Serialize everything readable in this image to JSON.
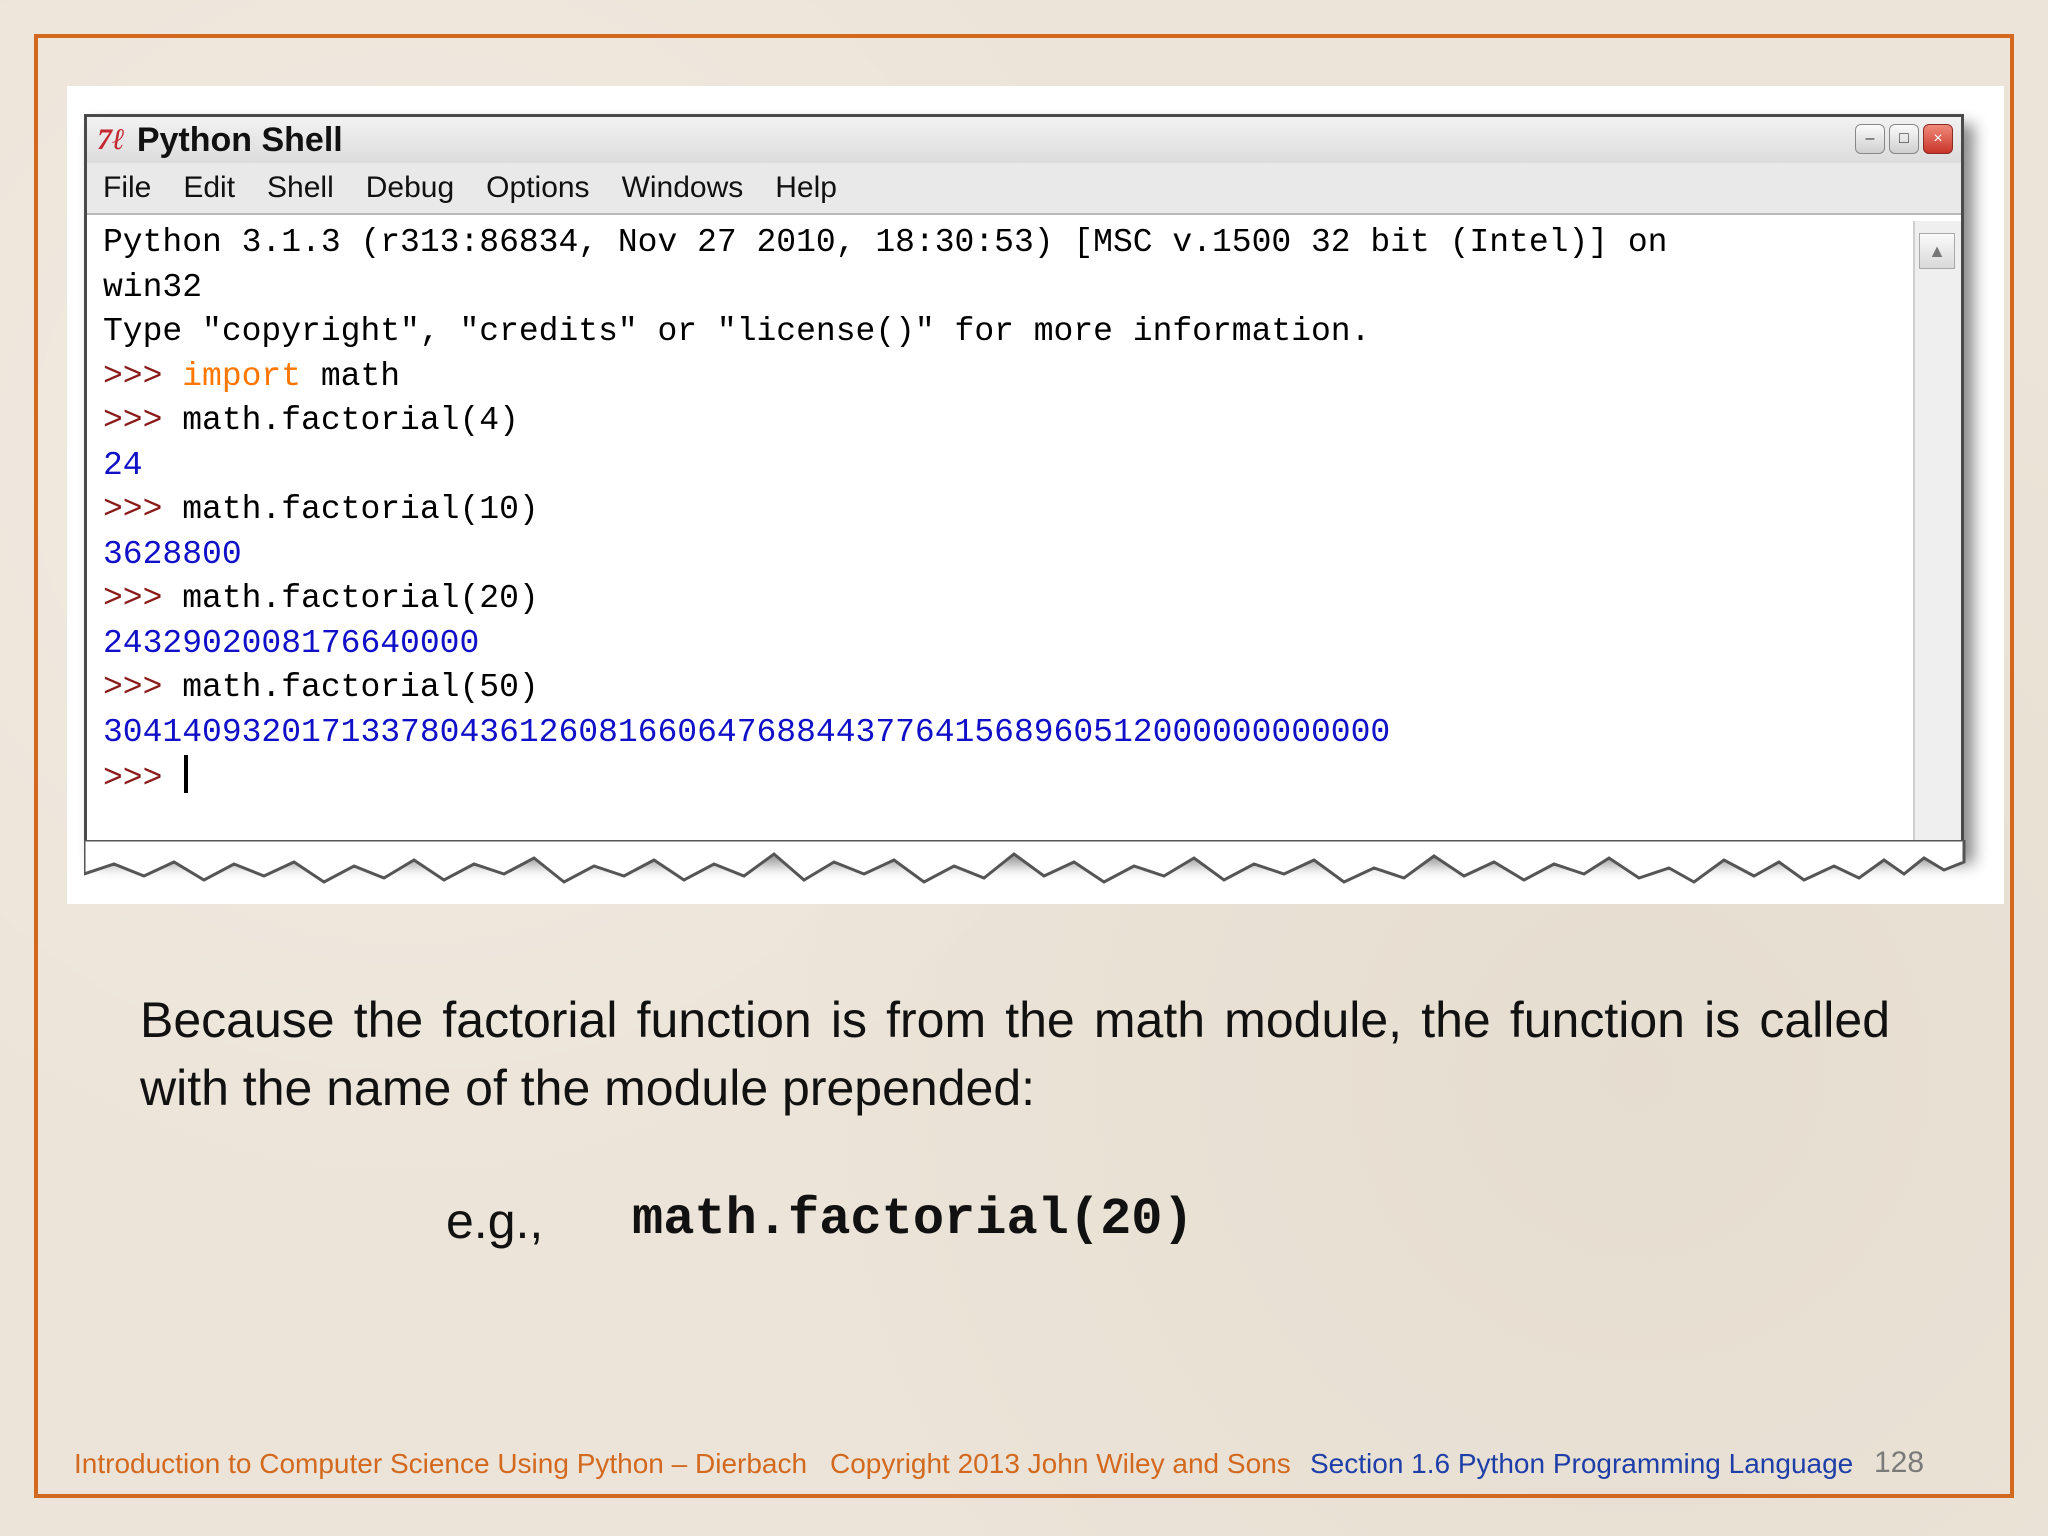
{
  "window": {
    "icon": "tk-icon",
    "icon_text": "7ℓ",
    "title": "Python Shell",
    "buttons": {
      "minimize": "–",
      "maximize": "□",
      "close": "×"
    }
  },
  "menu": [
    "File",
    "Edit",
    "Shell",
    "Debug",
    "Options",
    "Windows",
    "Help"
  ],
  "shell": {
    "lines": [
      {
        "parts": [
          {
            "text": "Python 3.1.3 (r313:86834, Nov 27 2010, 18:30:53) [MSC v.1500 32 bit (Intel)] on",
            "style": "plain"
          }
        ]
      },
      {
        "parts": [
          {
            "text": "win32",
            "style": "plain"
          }
        ]
      },
      {
        "parts": [
          {
            "text": "Type \"copyright\", \"credits\" or \"license()\" for more information.",
            "style": "plain"
          }
        ]
      },
      {
        "parts": [
          {
            "text": ">>> ",
            "style": "prompt"
          },
          {
            "text": "import",
            "style": "kw"
          },
          {
            "text": " math",
            "style": "plain"
          }
        ]
      },
      {
        "parts": [
          {
            "text": ">>> ",
            "style": "prompt"
          },
          {
            "text": "math.factorial(4)",
            "style": "plain"
          }
        ]
      },
      {
        "parts": [
          {
            "text": "24",
            "style": "out"
          }
        ]
      },
      {
        "parts": [
          {
            "text": ">>> ",
            "style": "prompt"
          },
          {
            "text": "math.factorial(10)",
            "style": "plain"
          }
        ]
      },
      {
        "parts": [
          {
            "text": "3628800",
            "style": "out"
          }
        ]
      },
      {
        "parts": [
          {
            "text": ">>> ",
            "style": "prompt"
          },
          {
            "text": "math.factorial(20)",
            "style": "plain"
          }
        ]
      },
      {
        "parts": [
          {
            "text": "2432902008176640000",
            "style": "out"
          }
        ]
      },
      {
        "parts": [
          {
            "text": ">>> ",
            "style": "prompt"
          },
          {
            "text": "math.factorial(50)",
            "style": "plain"
          }
        ]
      },
      {
        "parts": [
          {
            "text": "30414093201713378043612608166064768844377641568960512000000000000",
            "style": "out"
          }
        ]
      },
      {
        "parts": [
          {
            "text": ">>> ",
            "style": "prompt"
          }
        ],
        "cursor": true
      }
    ]
  },
  "slide": {
    "body": "Because the factorial function is from the math module, the function is called with the name of the module prepended:",
    "eg_label": "e.g.,",
    "eg_code": "math.factorial(20)"
  },
  "footer": {
    "book": "Introduction to Computer Science Using Python – Dierbach",
    "copyright": "Copyright 2013 John Wiley and  Sons",
    "section": "Section 1.6  Python Programming Language",
    "page": "128"
  },
  "colors": {
    "frame": "#d2691e",
    "prompt": "#8b1b1b",
    "keyword": "#ff7700",
    "output": "#1010c8",
    "footer_section": "#1f3fa8"
  }
}
